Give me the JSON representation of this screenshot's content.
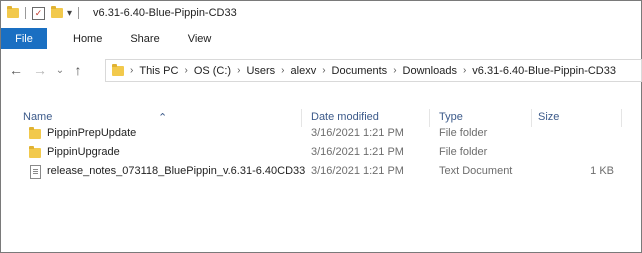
{
  "window": {
    "title": "v6.31-6.40-Blue-Pippin-CD33",
    "qa_dropdown": "▾"
  },
  "ribbon": {
    "tabs": [
      "File",
      "Home",
      "Share",
      "View"
    ]
  },
  "nav": {
    "back": "←",
    "forward": "→",
    "recent": "⌄",
    "up": "↑"
  },
  "breadcrumb": [
    "This PC",
    "OS (C:)",
    "Users",
    "alexv",
    "Documents",
    "Downloads",
    "v6.31-6.40-Blue-Pippin-CD33"
  ],
  "breadcrumb_sep": "›",
  "columns": {
    "name": "Name",
    "date": "Date modified",
    "type": "Type",
    "size": "Size"
  },
  "files": [
    {
      "name": "PippinPrepUpdate",
      "date": "3/16/2021 1:21 PM",
      "type": "File folder",
      "size": "",
      "icon": "folder-icon"
    },
    {
      "name": "PippinUpgrade",
      "date": "3/16/2021 1:21 PM",
      "type": "File folder",
      "size": "",
      "icon": "folder-icon"
    },
    {
      "name": "release_notes_073118_BluePippin_v.6.31-6.40CD33",
      "date": "3/16/2021 1:21 PM",
      "type": "Text Document",
      "size": "1 KB",
      "icon": "text-document-icon"
    }
  ],
  "colors": {
    "file_tab": "#1a6fc2",
    "folder": "#f2c94c",
    "header_text": "#3c5a8a"
  }
}
